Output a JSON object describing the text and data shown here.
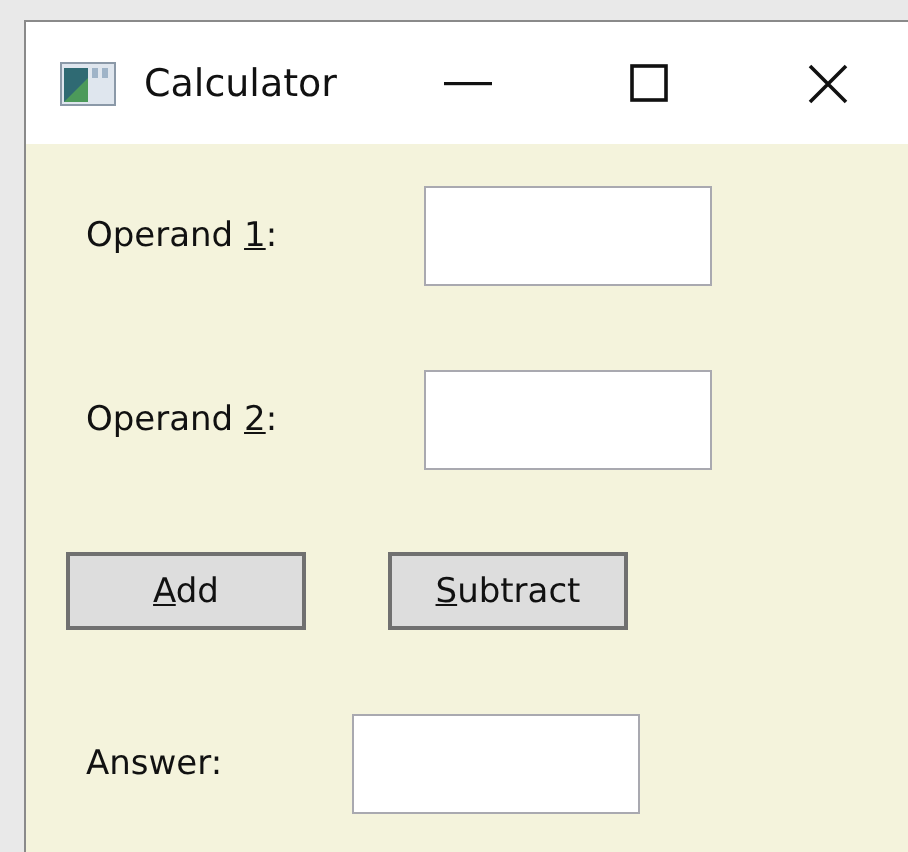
{
  "window": {
    "title": "Calculator",
    "controls": [
      {
        "kind": "minimize"
      },
      {
        "kind": "maximize"
      },
      {
        "kind": "close"
      }
    ]
  },
  "operands": [
    {
      "label": {
        "before": "Operand ",
        "access_key": "1",
        "after": ":"
      }
    },
    {
      "label": {
        "before": "Operand ",
        "access_key": "2",
        "after": ":"
      }
    }
  ],
  "buttons": [
    {
      "access_key": "A",
      "after": "dd"
    },
    {
      "access_key": "S",
      "after": "ubtract"
    }
  ],
  "answer": {
    "label": "Answer:"
  }
}
